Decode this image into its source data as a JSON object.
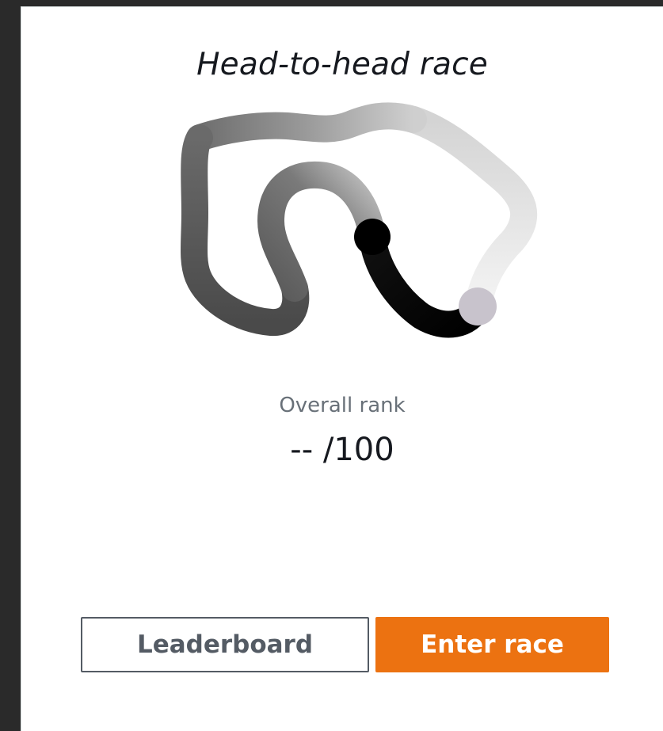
{
  "card": {
    "title": "Head-to-head race"
  },
  "track": {
    "icon": "race-track-icon",
    "colors": {
      "start_marker": "#000000",
      "end_marker": "#c8c3cc",
      "track_dark": "#000000",
      "track_light": "#f2f2f2"
    }
  },
  "rank": {
    "label": "Overall rank",
    "value": "-- /100"
  },
  "actions": {
    "leaderboard_label": "Leaderboard",
    "enter_race_label": "Enter race"
  },
  "colors": {
    "accent": "#ec7211",
    "secondary_border": "#545b64"
  }
}
